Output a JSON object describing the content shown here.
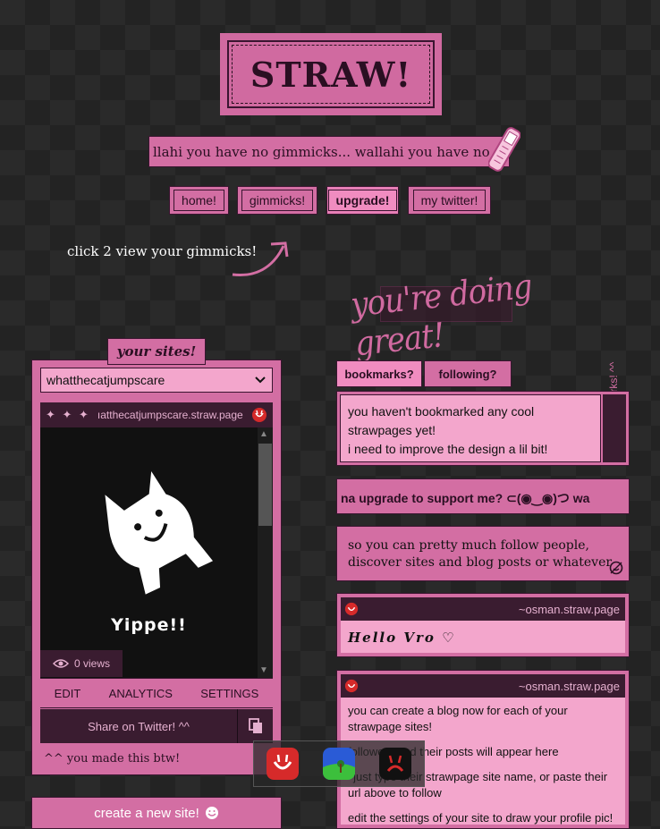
{
  "header": {
    "title": "STRAW!",
    "marquee": "llahi you have no gimmicks...       wallahi you have no gimmicks..."
  },
  "nav": {
    "home": "home!",
    "gimmicks": "gimmicks!",
    "upgrade": "upgrade!",
    "twitter": "my twitter!"
  },
  "hint": "click 2 view your gimmicks!",
  "banner": "you're doing great!",
  "sites": {
    "tab_label": "your sites!",
    "selected_site": "whatthecatjumpscare",
    "preview_url": "ıatthecatjumpscare.straw.page",
    "preview_stars": "✦ ✦ ✦",
    "preview_caption": "Yippe!!",
    "views": "0 views",
    "actions": [
      "EDIT",
      "ANALYTICS",
      "SETTINGS"
    ],
    "share_label": "Share on Twitter! ^^",
    "made_note": "^^ you made this btw!",
    "create_label": "create a new site!"
  },
  "tabs": {
    "bookmarks": "bookmarks?",
    "following": "following?"
  },
  "bookmarks": {
    "line1": "you haven't bookmarked any cool strawpages yet!",
    "line2": "i need to improve the design a lil bit!",
    "side_label": "your bookmarks! ^^"
  },
  "upgrade_marquee": "na upgrade to support me? ⊂(◉‿◉)つ        wa",
  "info_text": "so you can pretty much follow people, discover sites and blog posts or whatever",
  "posts": [
    {
      "site": "~osman.straw.page",
      "body": "Hello Vro ♡"
    },
    {
      "site": "~osman.straw.page",
      "paragraphs": [
        "you can create a blog now for each of your strawpage sites!",
        "followers and their posts will appear here",
        "^just type their strawpage site name, or paste their url above to follow",
        "edit the settings of your site to draw your profile pic!"
      ]
    }
  ],
  "colors": {
    "accent": "#d36ea3",
    "accent_light": "#f3a6cc",
    "dark_plum": "#3a1c30",
    "background": "#2a2a2a"
  },
  "icons": [
    "phone-icon",
    "arrow-icon",
    "chevron-down-icon",
    "eye-icon",
    "copy-icon",
    "smile-icon",
    "refresh-icon",
    "straw-logo-icon"
  ]
}
